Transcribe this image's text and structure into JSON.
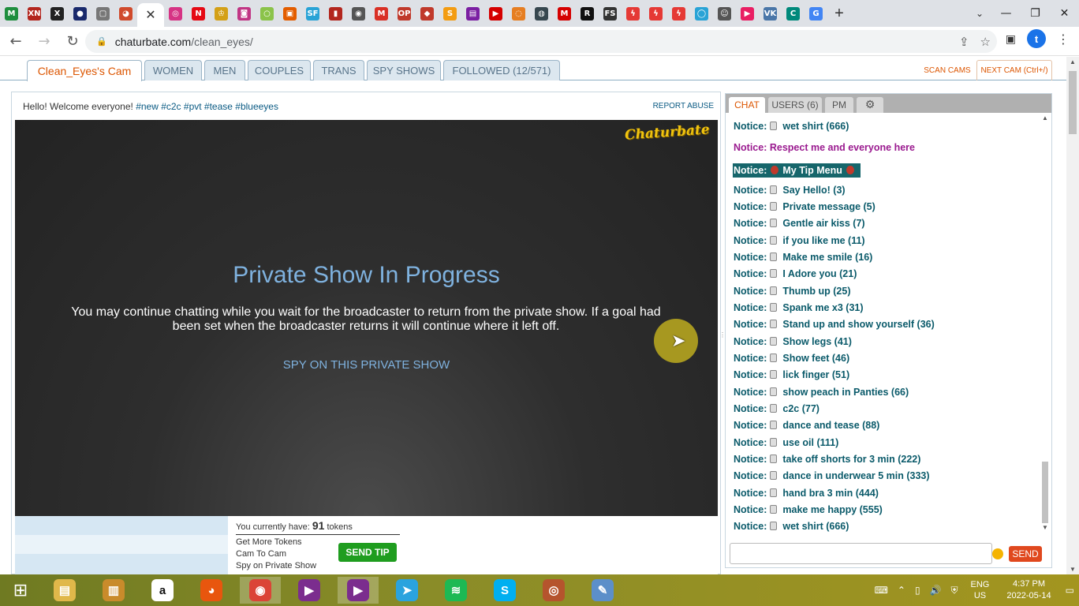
{
  "browser": {
    "tabs": [
      {
        "icon": "gmail-icon",
        "glyph": "M",
        "color": "#1e8e3e"
      },
      {
        "icon": "xn-icon",
        "glyph": "XN",
        "color": "#b3261e"
      },
      {
        "icon": "x-icon",
        "glyph": "X",
        "color": "#222222"
      },
      {
        "icon": "circle-icon",
        "glyph": "●",
        "color": "#1a2a6c"
      },
      {
        "icon": "box-icon",
        "glyph": "▢",
        "color": "#777777"
      },
      {
        "icon": "chat-bubble-icon",
        "glyph": "◕",
        "color": "#d04a2c"
      },
      {
        "icon": "target-icon",
        "glyph": "◎",
        "color": "#d63384"
      },
      {
        "icon": "netflix-icon",
        "glyph": "N",
        "color": "#e50914"
      },
      {
        "icon": "crown-icon",
        "glyph": "♔",
        "color": "#d4a017"
      },
      {
        "icon": "instagram-icon",
        "glyph": "◙",
        "color": "#c13584"
      },
      {
        "icon": "ring-icon",
        "glyph": "○",
        "color": "#8bc34a"
      },
      {
        "icon": "tv-icon",
        "glyph": "▣",
        "color": "#e35d00"
      },
      {
        "icon": "sf-icon",
        "glyph": "SF",
        "color": "#29a3d6"
      },
      {
        "icon": "book-icon",
        "glyph": "▮",
        "color": "#b3261e"
      },
      {
        "icon": "eye-icon",
        "glyph": "◉",
        "color": "#555555"
      },
      {
        "icon": "mail-icon",
        "glyph": "M",
        "color": "#d93025"
      },
      {
        "icon": "op-icon",
        "glyph": "OP",
        "color": "#c0392b"
      },
      {
        "icon": "diamond-icon",
        "glyph": "◆",
        "color": "#c0392b"
      },
      {
        "icon": "s-icon",
        "glyph": "S",
        "color": "#f39c12"
      },
      {
        "icon": "truck-icon",
        "glyph": "▤",
        "color": "#7b1fa2"
      },
      {
        "icon": "play-icon",
        "glyph": "▶",
        "color": "#d50000"
      },
      {
        "icon": "swirl-icon",
        "glyph": "◌",
        "color": "#e67e22"
      },
      {
        "icon": "compass-icon",
        "glyph": "◍",
        "color": "#37474f"
      },
      {
        "icon": "m-red-icon",
        "glyph": "M",
        "color": "#d50000"
      },
      {
        "icon": "r-icon",
        "glyph": "R",
        "color": "#111111"
      },
      {
        "icon": "fs-icon",
        "glyph": "FS",
        "color": "#333333"
      },
      {
        "icon": "bolt-icon",
        "glyph": "ϟ",
        "color": "#e53935"
      },
      {
        "icon": "bolt-icon-2",
        "glyph": "ϟ",
        "color": "#e53935"
      },
      {
        "icon": "bolt-icon-3",
        "glyph": "ϟ",
        "color": "#e53935"
      },
      {
        "icon": "globe-icon",
        "glyph": "◯",
        "color": "#29a3d6"
      },
      {
        "icon": "person-icon",
        "glyph": "☺",
        "color": "#555555"
      },
      {
        "icon": "video-icon",
        "glyph": "▶",
        "color": "#e91e63"
      },
      {
        "icon": "vk-icon",
        "glyph": "VK",
        "color": "#4a76a8"
      },
      {
        "icon": "c-icon",
        "glyph": "C",
        "color": "#00897b"
      },
      {
        "icon": "translate-icon",
        "glyph": "G",
        "color": "#4285f4"
      }
    ],
    "active_tab_close": "✕",
    "new_tab": "+",
    "url_domain": "chaturbate.com",
    "url_path": "/clean_eyes/",
    "profile_initial": "t"
  },
  "site_nav": {
    "tabs": [
      "Clean_Eyes's Cam",
      "WOMEN",
      "MEN",
      "COUPLES",
      "TRANS",
      "SPY SHOWS",
      "FOLLOWED (12/571)"
    ],
    "scan_cams": "SCAN CAMS",
    "next_cam": "NEXT CAM (Ctrl+/)"
  },
  "room": {
    "subject_text": "Hello! Welcome everyone! ",
    "subject_tags": "#new #c2c #pvt #tease #blueeyes",
    "report_abuse": "REPORT ABUSE",
    "logo": "Chaturbate",
    "private_title": "Private Show In Progress",
    "private_text": "You may continue chatting while you wait for the broadcaster to return from the private show. If a goal had been set when the broadcaster returns it will continue where it left off.",
    "spy_link": "SPY ON THIS PRIVATE SHOW"
  },
  "tip": {
    "tokens_prefix": "You currently have: ",
    "tokens_count": "91",
    "tokens_suffix": " tokens",
    "get_more": "Get More Tokens",
    "cam_to_cam": "Cam To Cam",
    "spy_private": "Spy on Private Show",
    "send_tip": "SEND TIP"
  },
  "chat": {
    "tabs": [
      "CHAT",
      "USERS (6)",
      "PM"
    ],
    "settings_icon": "gear-icon",
    "messages": [
      {
        "prefix": "Notice:",
        "text": "wet shirt (666)",
        "style": "normal"
      },
      {
        "prefix": "Notice:",
        "text": "Respect me and everyone here",
        "style": "purple"
      },
      {
        "prefix": "Notice:",
        "text": "My Tip Menu",
        "style": "highlight"
      },
      {
        "prefix": "Notice:",
        "text": "Say Hello! (3)",
        "style": "normal"
      },
      {
        "prefix": "Notice:",
        "text": "Private message (5)",
        "style": "normal"
      },
      {
        "prefix": "Notice:",
        "text": "Gentle air kiss (7)",
        "style": "normal"
      },
      {
        "prefix": "Notice:",
        "text": "if you like me (11)",
        "style": "normal"
      },
      {
        "prefix": "Notice:",
        "text": "Make me smile (16)",
        "style": "normal"
      },
      {
        "prefix": "Notice:",
        "text": "I Adore you (21)",
        "style": "normal"
      },
      {
        "prefix": "Notice:",
        "text": "Thumb up (25)",
        "style": "normal"
      },
      {
        "prefix": "Notice:",
        "text": "Spank me x3 (31)",
        "style": "normal"
      },
      {
        "prefix": "Notice:",
        "text": "Stand up and show yourself (36)",
        "style": "normal"
      },
      {
        "prefix": "Notice:",
        "text": "Show legs (41)",
        "style": "normal"
      },
      {
        "prefix": "Notice:",
        "text": "Show feet (46)",
        "style": "normal"
      },
      {
        "prefix": "Notice:",
        "text": "lick finger (51)",
        "style": "normal"
      },
      {
        "prefix": "Notice:",
        "text": "show peach in Panties (66)",
        "style": "normal"
      },
      {
        "prefix": "Notice:",
        "text": "c2c (77)",
        "style": "normal"
      },
      {
        "prefix": "Notice:",
        "text": "dance and tease (88)",
        "style": "normal"
      },
      {
        "prefix": "Notice:",
        "text": "use oil (111)",
        "style": "normal"
      },
      {
        "prefix": "Notice:",
        "text": "take off shorts for 3 min (222)",
        "style": "normal"
      },
      {
        "prefix": "Notice:",
        "text": "dance in underwear 5 min (333)",
        "style": "normal"
      },
      {
        "prefix": "Notice:",
        "text": "hand bra 3 min (444)",
        "style": "normal"
      },
      {
        "prefix": "Notice:",
        "text": "make me happy (555)",
        "style": "normal"
      },
      {
        "prefix": "Notice:",
        "text": "wet shirt (666)",
        "style": "normal"
      }
    ],
    "send": "SEND"
  },
  "taskbar": {
    "apps": [
      {
        "icon": "file-explorer-icon",
        "glyph": "▤",
        "color": "#e0b84a"
      },
      {
        "icon": "notes-icon",
        "glyph": "▥",
        "color": "#c98b2b"
      },
      {
        "icon": "amazon-icon",
        "glyph": "a",
        "color": "#ffffff"
      },
      {
        "icon": "firefox-icon",
        "glyph": "◕",
        "color": "#e8560e"
      },
      {
        "icon": "chrome-icon",
        "glyph": "◉",
        "color": "#db4437"
      },
      {
        "icon": "video-call-icon",
        "glyph": "▶",
        "color": "#7b2d8e"
      },
      {
        "icon": "video-call-icon-2",
        "glyph": "▶",
        "color": "#7b2d8e"
      },
      {
        "icon": "telegram-icon",
        "glyph": "➤",
        "color": "#2aa3de"
      },
      {
        "icon": "spotify-icon",
        "glyph": "≋",
        "color": "#1db954"
      },
      {
        "icon": "skype-icon",
        "glyph": "S",
        "color": "#00aff0"
      },
      {
        "icon": "media-icon",
        "glyph": "◎",
        "color": "#b5542d"
      },
      {
        "icon": "paint-icon",
        "glyph": "✎",
        "color": "#5c8fc9"
      }
    ],
    "lang_top": "ENG",
    "lang_bottom": "US",
    "time": "4:37 PM",
    "date": "2022-05-14"
  }
}
